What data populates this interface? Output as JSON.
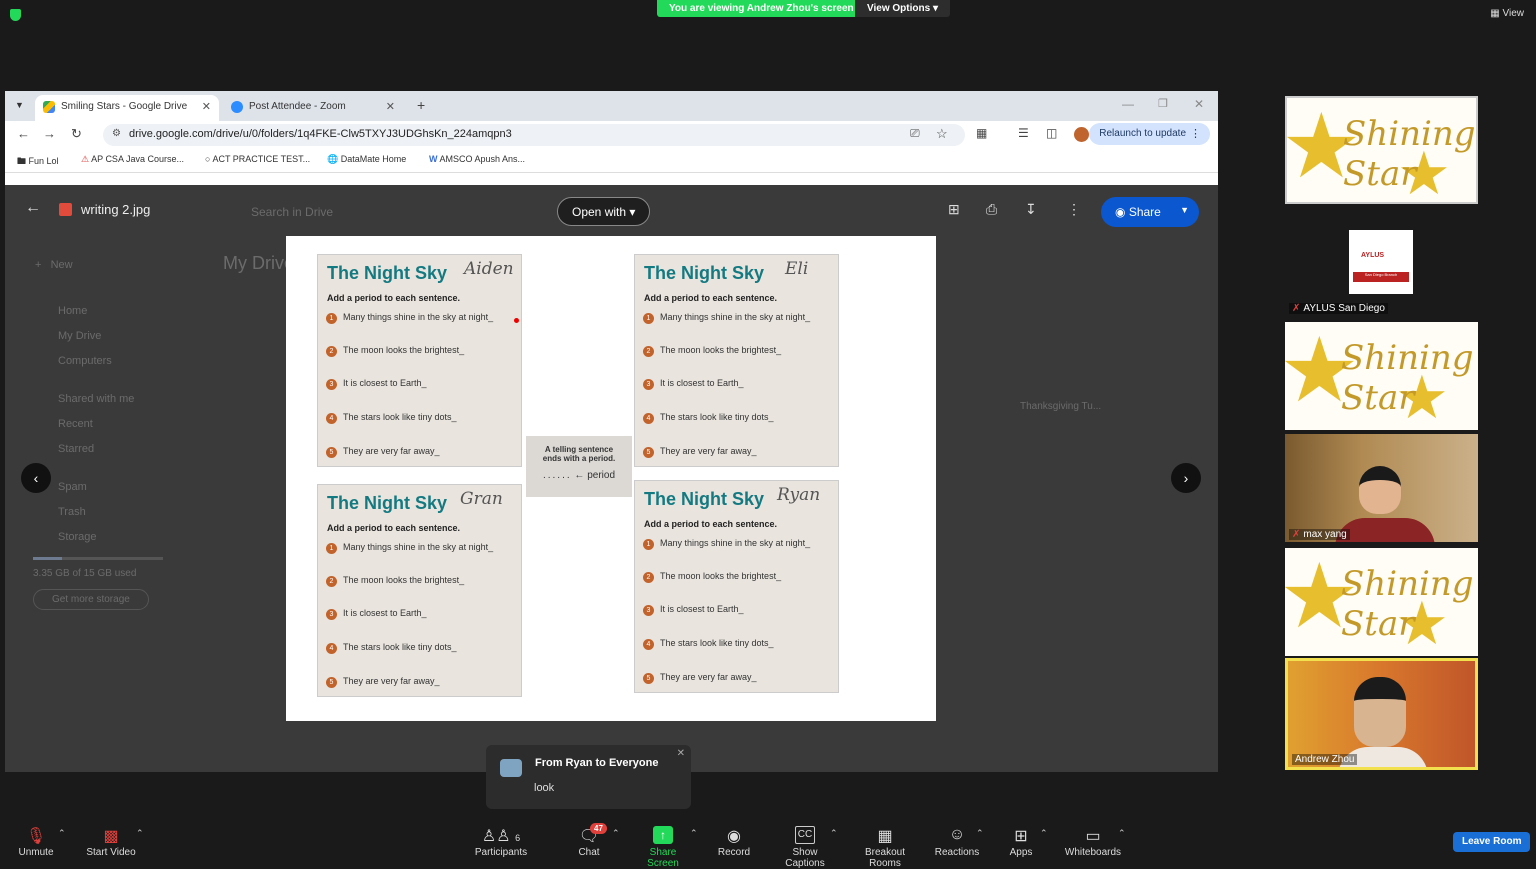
{
  "zoom": {
    "banner": "You are viewing Andrew Zhou's screen",
    "view_options": "View Options",
    "view": "View"
  },
  "browser": {
    "tabs": [
      {
        "label": "Smiling Stars - Google Drive"
      },
      {
        "label": "Post Attendee - Zoom"
      }
    ],
    "url": "drive.google.com/drive/u/0/folders/1q4FKE-Clw5TXYJ3UDGhsKn_224amqpn3",
    "relaunch": "Relaunch to update",
    "bookmarks": [
      "Fun Lol",
      "AP CSA Java Course...",
      "ACT PRACTICE TEST...",
      "DataMate Home",
      "AMSCO Apush Ans..."
    ]
  },
  "viewer": {
    "filename": "writing 2.jpg",
    "open_with": "Open with",
    "share": "Share",
    "search_placeholder": "Search in Drive",
    "behind": {
      "new": "New",
      "my_drive_title": "My Drive",
      "nav": [
        "Home",
        "My Drive",
        "Computers",
        "Shared with me",
        "Recent",
        "Starred",
        "Spam",
        "Trash",
        "Storage"
      ],
      "storage": "3.35 GB of 15 GB used",
      "get_storage": "Get more storage",
      "thanksgiving": "Thanksgiving Tu..."
    }
  },
  "worksheet": {
    "title": "The Night Sky",
    "instruction": "Add a period to each sentence.",
    "sentences": [
      "Many things shine in the sky at night_",
      "The moon looks the brightest_",
      "It is closest to Earth_",
      "The stars look like tiny dots_",
      "They are very far away_"
    ],
    "names": [
      "Aiden",
      "Eli",
      "Gran",
      "Ryan"
    ],
    "note_line1": "A telling sentence",
    "note_line2": "ends with a period.",
    "note_period": "period"
  },
  "gallery": {
    "star_text": "Shining Star",
    "aylus_name": "AYLUS San Diego",
    "aylus_logo": "AYLUS",
    "aylus_sub": "San Diego Branch",
    "max_name": "max yang",
    "andrew_name": "Andrew Zhou"
  },
  "chat_popup": {
    "from": "From Ryan to Everyone",
    "message": "look"
  },
  "toolbar": {
    "unmute": "Unmute",
    "start_video": "Start Video",
    "participants": "Participants",
    "participants_count": "6",
    "chat": "Chat",
    "chat_badge": "47",
    "share_screen": "Share Screen",
    "record": "Record",
    "show_captions": "Show Captions",
    "breakout_rooms": "Breakout Rooms",
    "reactions": "Reactions",
    "apps": "Apps",
    "whiteboards": "Whiteboards",
    "leave_room": "Leave Room"
  },
  "colors": {
    "zoom_green": "#23d959",
    "share_blue": "#0b57d0",
    "teal_title": "#147a82"
  }
}
